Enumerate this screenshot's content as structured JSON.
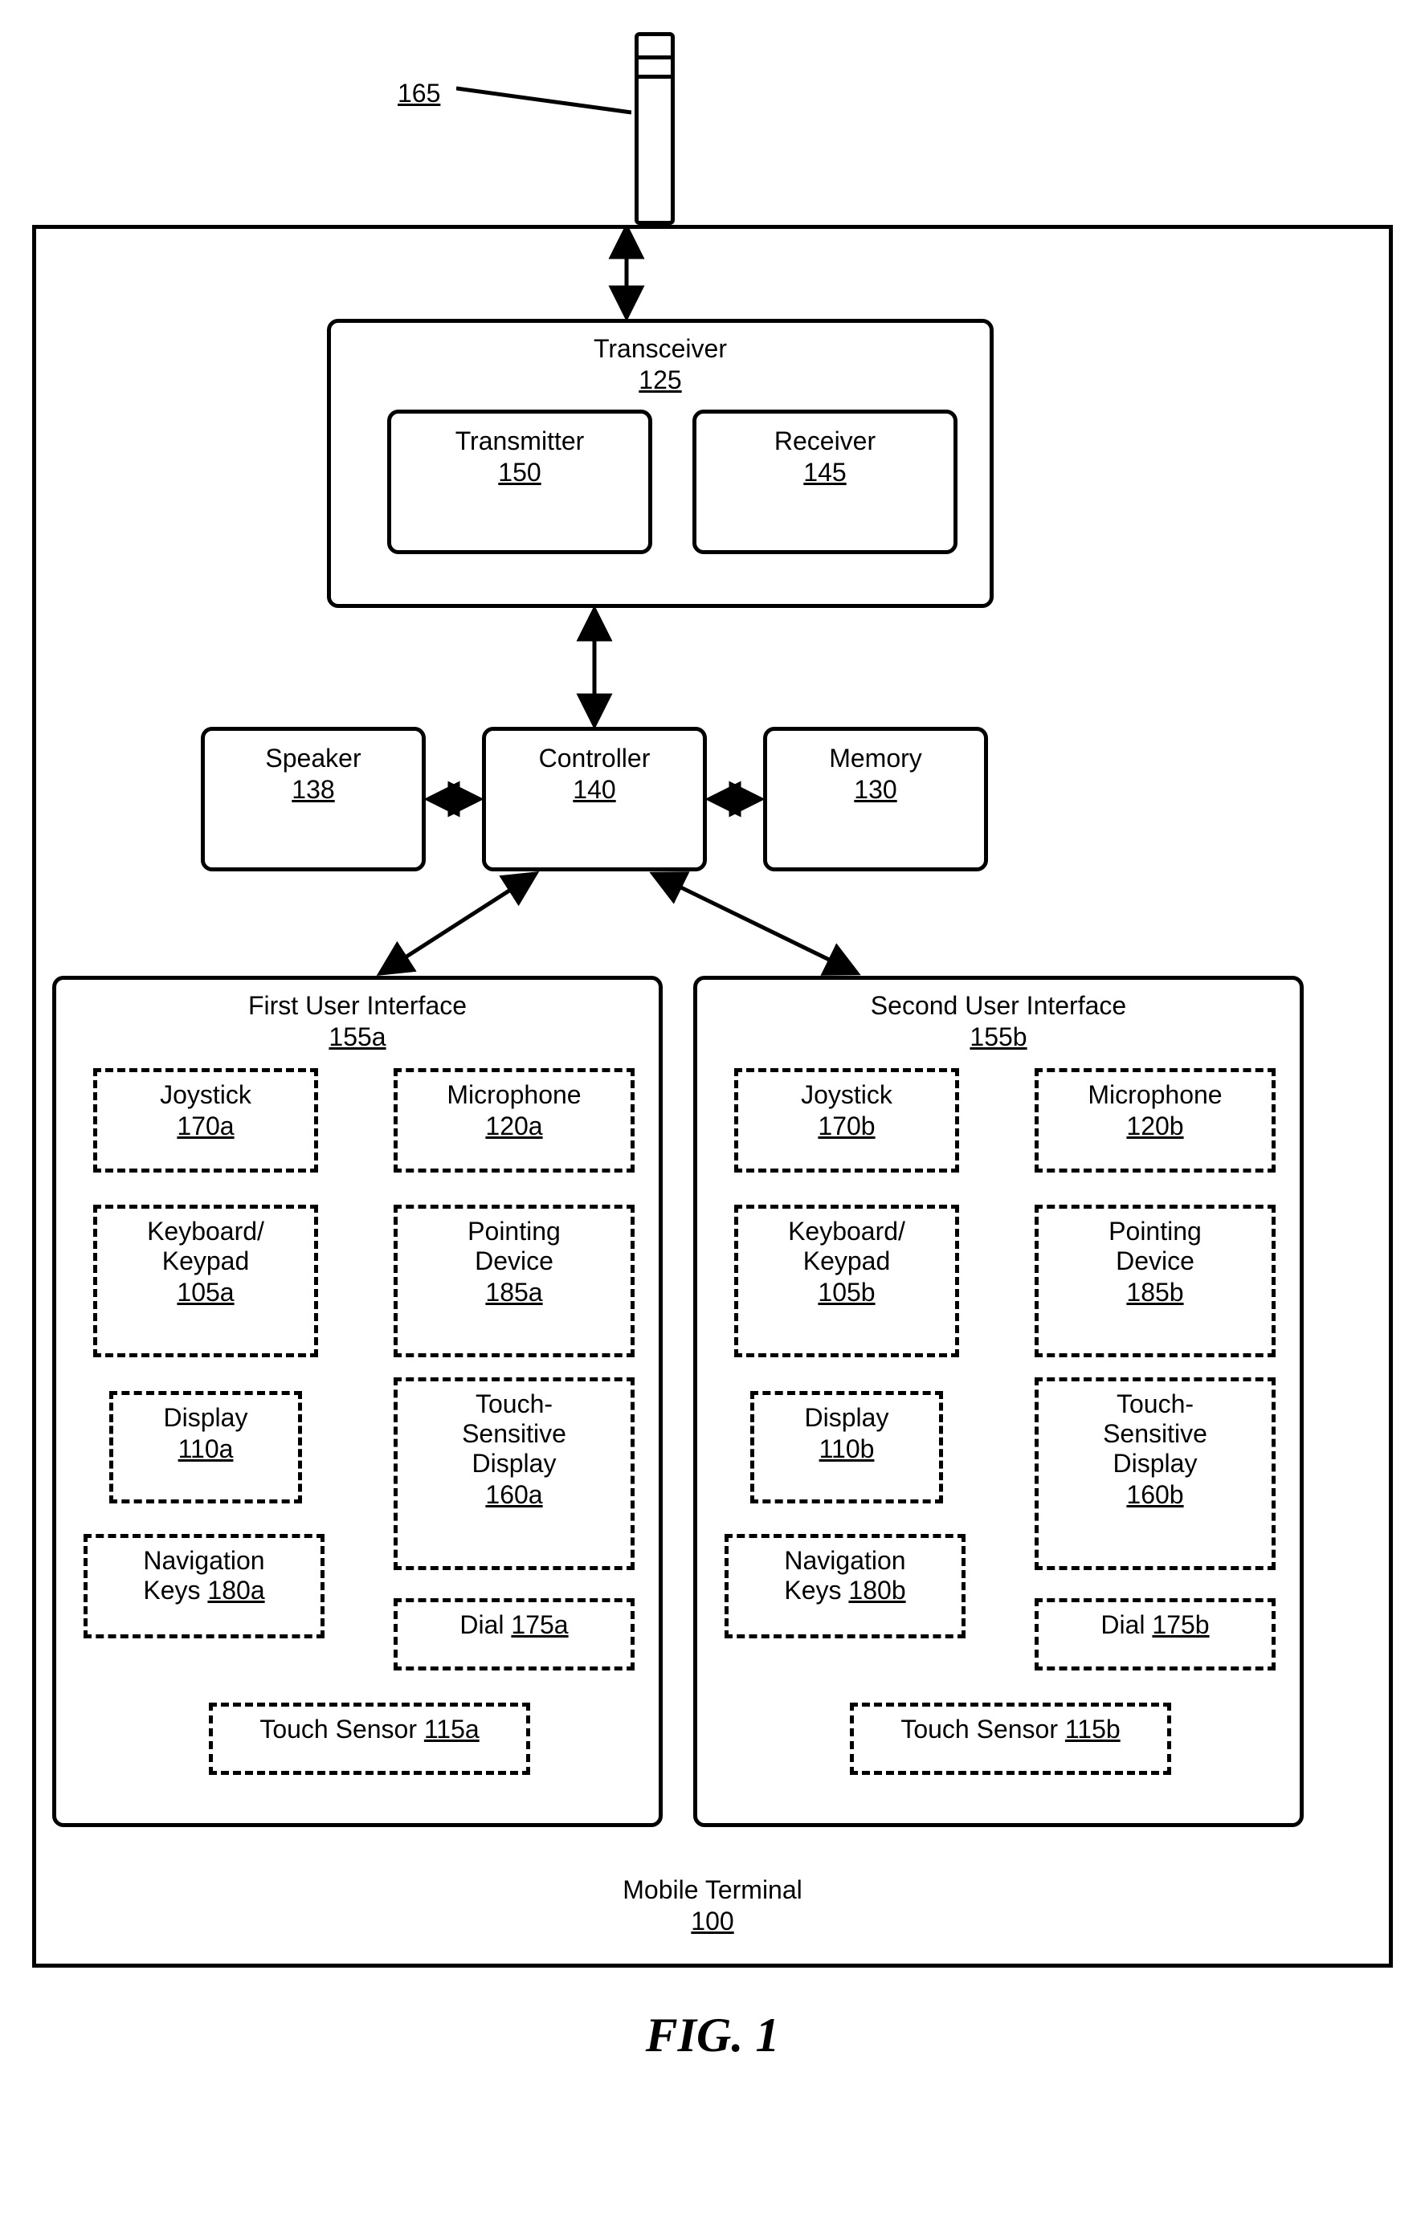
{
  "figure_caption": "FIG. 1",
  "antenna": {
    "ref": "165"
  },
  "terminal": {
    "title": "Mobile Terminal",
    "ref": "100"
  },
  "transceiver": {
    "title": "Transceiver",
    "ref": "125"
  },
  "transmitter": {
    "title": "Transmitter",
    "ref": "150"
  },
  "receiver": {
    "title": "Receiver",
    "ref": "145"
  },
  "speaker": {
    "title": "Speaker",
    "ref": "138"
  },
  "controller": {
    "title": "Controller",
    "ref": "140"
  },
  "memory": {
    "title": "Memory",
    "ref": "130"
  },
  "ui_a": {
    "title": "First User Interface",
    "ref": "155a",
    "joystick": {
      "title": "Joystick",
      "ref": "170a"
    },
    "microphone": {
      "title": "Microphone",
      "ref": "120a"
    },
    "keypad": {
      "title": "Keyboard/\nKeypad",
      "ref": "105a"
    },
    "pointing": {
      "title": "Pointing\nDevice",
      "ref": "185a"
    },
    "display": {
      "title": "Display",
      "ref": "110a"
    },
    "tsd": {
      "title": "Touch-\nSensitive\nDisplay",
      "ref": "160a"
    },
    "nav": {
      "title": "Navigation\nKeys ",
      "ref": "180a"
    },
    "dial": {
      "title": "Dial ",
      "ref": "175a"
    },
    "touch": {
      "title": "Touch Sensor ",
      "ref": "115a"
    }
  },
  "ui_b": {
    "title": "Second User Interface",
    "ref": "155b",
    "joystick": {
      "title": "Joystick",
      "ref": "170b"
    },
    "microphone": {
      "title": "Microphone",
      "ref": "120b"
    },
    "keypad": {
      "title": "Keyboard/\nKeypad",
      "ref": "105b"
    },
    "pointing": {
      "title": "Pointing\nDevice",
      "ref": "185b"
    },
    "display": {
      "title": "Display",
      "ref": "110b"
    },
    "tsd": {
      "title": "Touch-\nSensitive\nDisplay",
      "ref": "160b"
    },
    "nav": {
      "title": "Navigation\nKeys ",
      "ref": "180b"
    },
    "dial": {
      "title": "Dial ",
      "ref": "175b"
    },
    "touch": {
      "title": "Touch Sensor ",
      "ref": "115b"
    }
  }
}
